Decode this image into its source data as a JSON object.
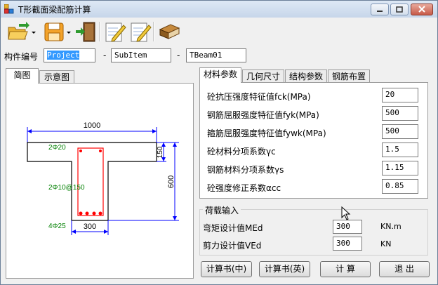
{
  "window": {
    "title": "T形截面梁配筋计算"
  },
  "toolbar": {
    "buttons": [
      {
        "name": "open-icon"
      },
      {
        "name": "save-icon"
      },
      {
        "name": "exit-icon"
      },
      {
        "name": "edit-icon"
      },
      {
        "name": "edit2-icon"
      },
      {
        "name": "book-icon"
      }
    ]
  },
  "member": {
    "label": "构件编号",
    "project": "Project",
    "subitem": "SubItem",
    "beam": "TBeam01",
    "dash": "-"
  },
  "left_tabs": [
    "简图",
    "示意图"
  ],
  "drawing": {
    "width_top": "1000",
    "height_total": "600",
    "flange_thickness": "150",
    "web_width": "300",
    "top_rebar": "2Φ20",
    "stirrup": "2Φ10@150",
    "bottom_rebar": "4Φ25",
    "colors": {
      "dim": "#0000ff",
      "rebar": "#ff0000",
      "text": "#008000",
      "outline": "#000000"
    }
  },
  "right_tabs": [
    "材料参数",
    "几何尺寸",
    "结构参数",
    "钢筋布置"
  ],
  "params": [
    {
      "label": "砼抗压强度特征值fck(MPa)",
      "value": "20"
    },
    {
      "label": "钢筋屈服强度特征值fyk(MPa)",
      "value": "500"
    },
    {
      "label": "箍筋屈服强度特征值fywk(MPa)",
      "value": "500"
    },
    {
      "label": "砼材料分项系数γc",
      "value": "1.5"
    },
    {
      "label": "钢筋材料分项系数γs",
      "value": "1.15"
    },
    {
      "label": "砼强度修正系数αcc",
      "value": "0.85"
    }
  ],
  "load": {
    "title": "荷载输入",
    "moment_label": "弯矩设计值MEd",
    "moment_value": "300",
    "moment_unit": "KN.m",
    "shear_label": "剪力设计值VEd",
    "shear_value": "300",
    "shear_unit": "KN"
  },
  "actions": {
    "calc_cn": "计算书(中)",
    "calc_en": "计算书(英)",
    "calc": "计 算",
    "exit": "退 出"
  }
}
